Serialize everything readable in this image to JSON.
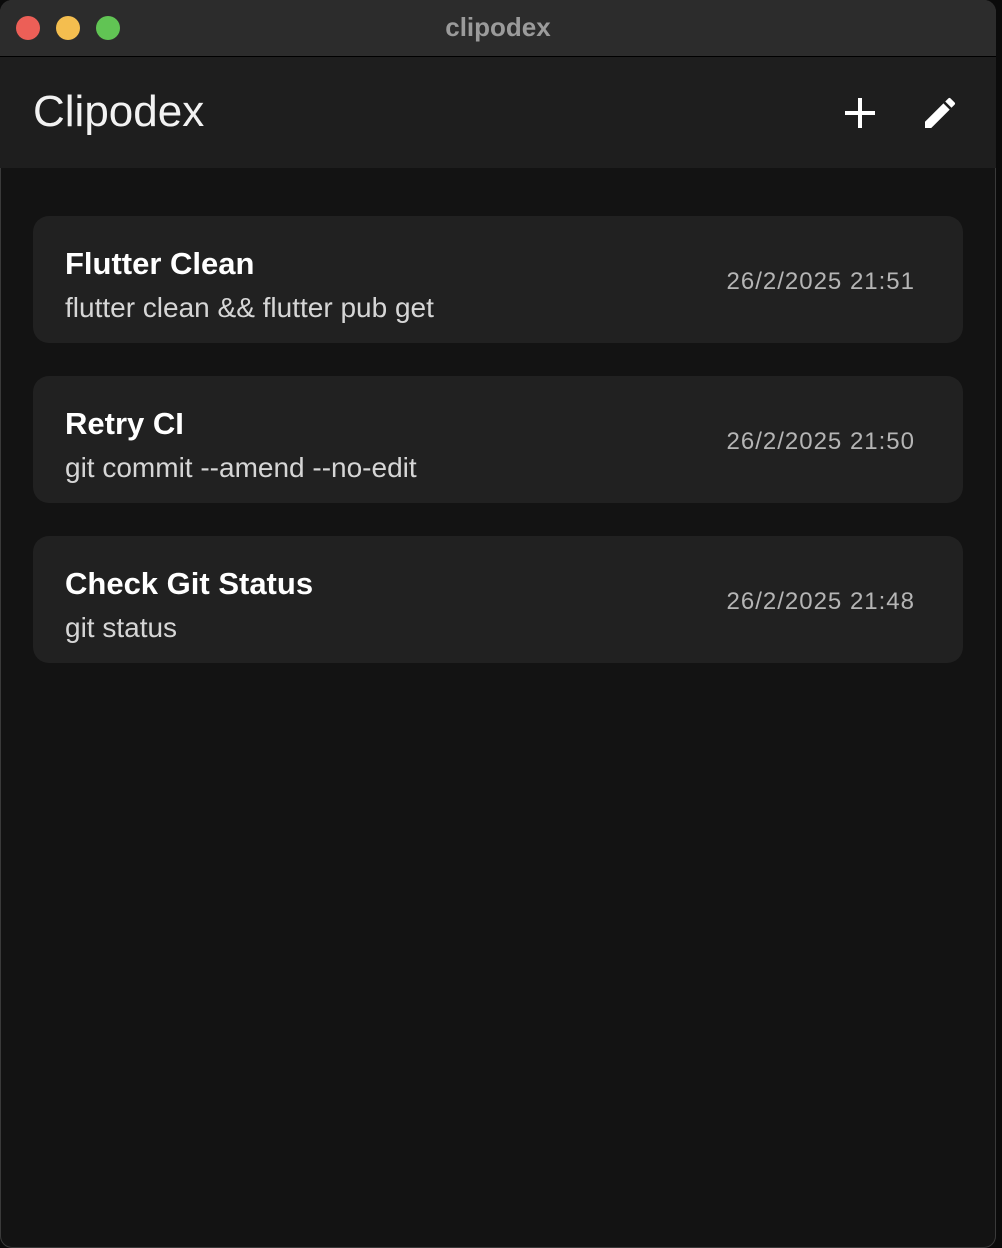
{
  "window": {
    "title": "clipodex"
  },
  "appbar": {
    "title": "Clipodex",
    "add_icon": "plus-icon",
    "edit_icon": "pencil-icon"
  },
  "colors": {
    "window_bg": "#131313",
    "appbar_bg": "#1e1e1e",
    "card_bg": "#212121",
    "close": "#ec5f57",
    "minimize": "#f4be4f",
    "zoom": "#61c454"
  },
  "clips": [
    {
      "title": "Flutter Clean",
      "command": "flutter clean && flutter pub get",
      "timestamp": "26/2/2025 21:51"
    },
    {
      "title": "Retry CI",
      "command": "git commit --amend --no-edit",
      "timestamp": "26/2/2025 21:50"
    },
    {
      "title": "Check Git Status",
      "command": "git status",
      "timestamp": "26/2/2025 21:48"
    }
  ]
}
